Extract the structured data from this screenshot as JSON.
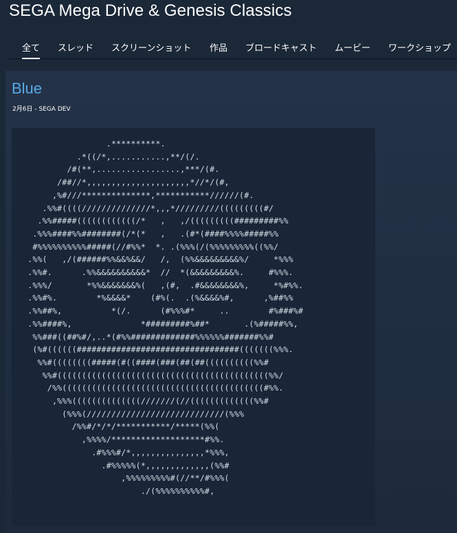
{
  "app": {
    "title": "SEGA Mega Drive & Genesis Classics"
  },
  "nav": {
    "tabs": [
      {
        "label": "全て"
      },
      {
        "label": "スレッド"
      },
      {
        "label": "スクリーンショット"
      },
      {
        "label": "作品"
      },
      {
        "label": "ブロードキャスト"
      },
      {
        "label": "ムービー"
      },
      {
        "label": "ワークショップ"
      }
    ]
  },
  "post": {
    "title": "Blue",
    "date": "2月6日",
    "separator": " - ",
    "author": "SEGA DEV",
    "ascii_art": "                 .**********.\n           .*((/*,...........,**/(/.\n         /#(**,.................,***/(#.\n       /##//*,,,,,,,,,,,,,,,,,,,,,*//*/(#,\n      ,%#///**************,***********//////(#.\n    .%%#((((//////////////*,,,*/////////(((((((((#/\n   .%%#####((((((((((((/*   ,   ,/(((((((((#########%%\n  .%%%####%%########(/*(*   ,   .(#*(####%%%%#####%%\n  #%%%%%%%%%%#####(//#%%*  *. .(%%%(/(%%%%%%%%%((%%/\n .%%(   ,/(######%%&&%&&/   /,  (%%&&&&&&&&&%/     *%%%\n .%%#.      .%%&&&&&&&&&&*  //  *(&&&&&&&&&%.     #%%%.\n .%%%/       *%%&&&&&&&%(   ,(#,  .#&&&&&&&&%,     *%#%%.\n .%%#%.        *%&&&&*    (#%(.  .(%&&&&%#,      ,%##%%\n .%%##%,          *(/.      (#%%%#*     ..        #%###%#\n .%%####%,              *#########%##*       .(%#####%%,\n  %%###((##%#/,..*(#%%#############%%%%%%#######%%#\n  (%#((((((#################################(((((((%%%.\n   %%#((((((((#####(#((####(###(##(##((((((((((%%#\n    %%#(((((((((((((((((((((((((((((((((((((((((((%%/\n     /%%(((((((((((((((((((((((((((((((((((((((((#%%.\n      ,%%%((((((((((((((///////(//(((((((((((((%%#\n        (%%%(////////////////////////////(%%%\n          /%%#/*/*/***********/*****(%%(\n            ,%%%%/*******************#%%.\n              .#%%%#/*,,,,,,,,,,,,,,,*%%%,\n                .#%%%%%(*,,,,,,,,,,,,,(%%#\n                    ,%%%%%%%%%#(//**/#%%%(\n                        ./(%%%%%%%%%%#,"
  }
}
